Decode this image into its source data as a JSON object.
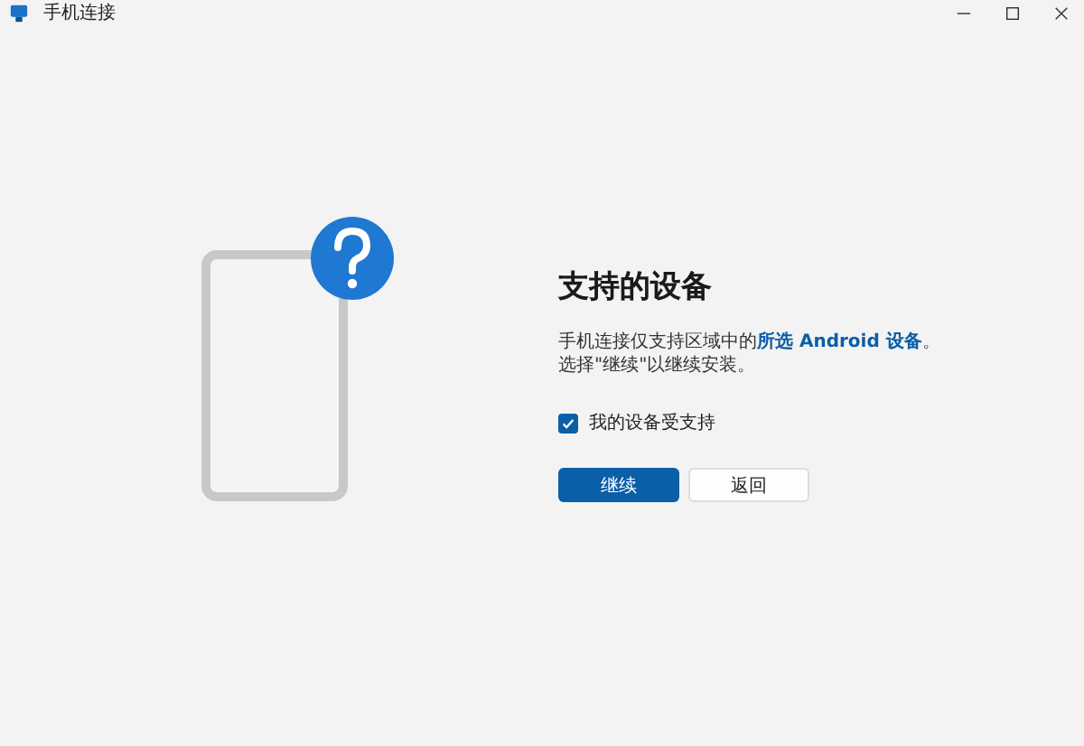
{
  "window": {
    "title": "手机连接"
  },
  "heading": "支持的设备",
  "description": {
    "before": "手机连接仅支持区域中的",
    "link": "所选 Android 设备",
    "after": "。",
    "line2": "选择\"继续\"以继续安装。"
  },
  "checkbox": {
    "label": "我的设备受支持",
    "checked": true
  },
  "buttons": [
    {
      "label": "继续",
      "kind": "primary"
    },
    {
      "label": "返回",
      "kind": "secondary"
    }
  ]
}
